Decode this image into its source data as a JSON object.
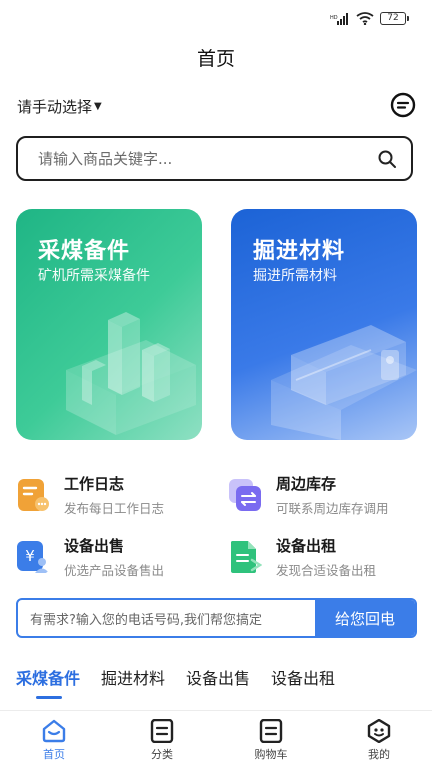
{
  "status_bar": {
    "battery": "72"
  },
  "header": {
    "title": "首页"
  },
  "location": {
    "label": "请手动选择"
  },
  "search": {
    "placeholder": "请输入商品关键字..."
  },
  "cards": [
    {
      "title": "采煤备件",
      "subtitle": "矿机所需采煤备件"
    },
    {
      "title": "掘进材料",
      "subtitle": "掘进所需材料"
    }
  ],
  "services": [
    {
      "title": "工作日志",
      "subtitle": "发布每日工作日志",
      "icon": "work-log-icon",
      "color": "#f0a237"
    },
    {
      "title": "周边库存",
      "subtitle": "可联系周边库存调用",
      "icon": "nearby-stock-icon",
      "color": "#7a6bf0"
    },
    {
      "title": "设备出售",
      "subtitle": "优选产品设备售出",
      "icon": "equipment-sale-icon",
      "color": "#3b7de8"
    },
    {
      "title": "设备出租",
      "subtitle": "发现合适设备出租",
      "icon": "equipment-rent-icon",
      "color": "#2fc27c"
    }
  ],
  "callback": {
    "placeholder": "有需求?输入您的电话号码,我们帮您搞定",
    "button": "给您回电"
  },
  "tabs": [
    "采煤备件",
    "掘进材料",
    "设备出售",
    "设备出租"
  ],
  "nav": [
    "首页",
    "分类",
    "购物车",
    "我的"
  ],
  "colors": {
    "primary": "#3b7de8",
    "green_card": "#1fb585",
    "blue_card": "#1c63d6"
  }
}
